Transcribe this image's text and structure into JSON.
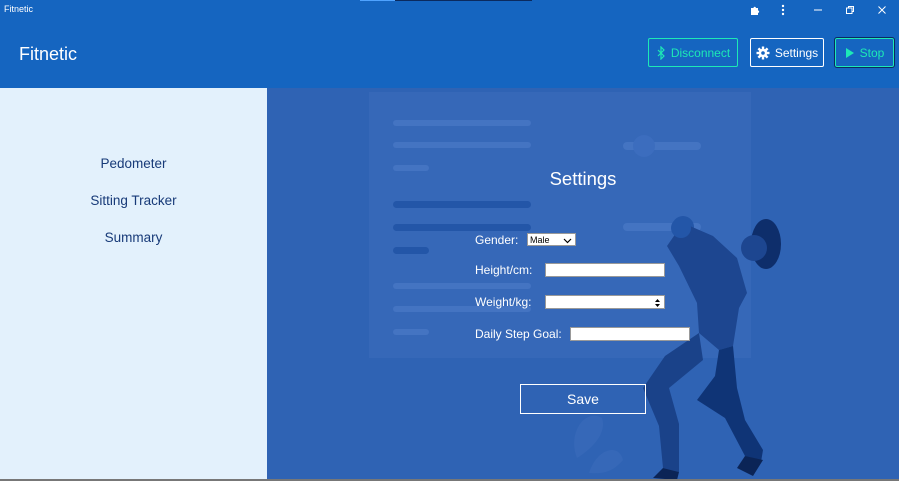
{
  "window": {
    "title": "Fitnetic"
  },
  "header": {
    "app_title": "Fitnetic",
    "disconnect_label": "Disconnect",
    "settings_label": "Settings",
    "stop_label": "Stop"
  },
  "sidebar": {
    "items": [
      {
        "label": "Pedometer"
      },
      {
        "label": "Sitting Tracker"
      },
      {
        "label": "Summary"
      }
    ]
  },
  "settings": {
    "title": "Settings",
    "gender_label": "Gender:",
    "gender_value": "Male",
    "height_label": "Height/cm:",
    "height_value": "",
    "weight_label": "Weight/kg:",
    "weight_value": "",
    "step_goal_label": "Daily Step Goal:",
    "step_goal_value": "",
    "save_label": "Save"
  },
  "colors": {
    "header_bg": "#1565c0",
    "accent": "#1de9b6",
    "sidebar_bg": "#e3f1fc",
    "main_bg": "#2f63b4",
    "nav_text": "#173a78"
  }
}
